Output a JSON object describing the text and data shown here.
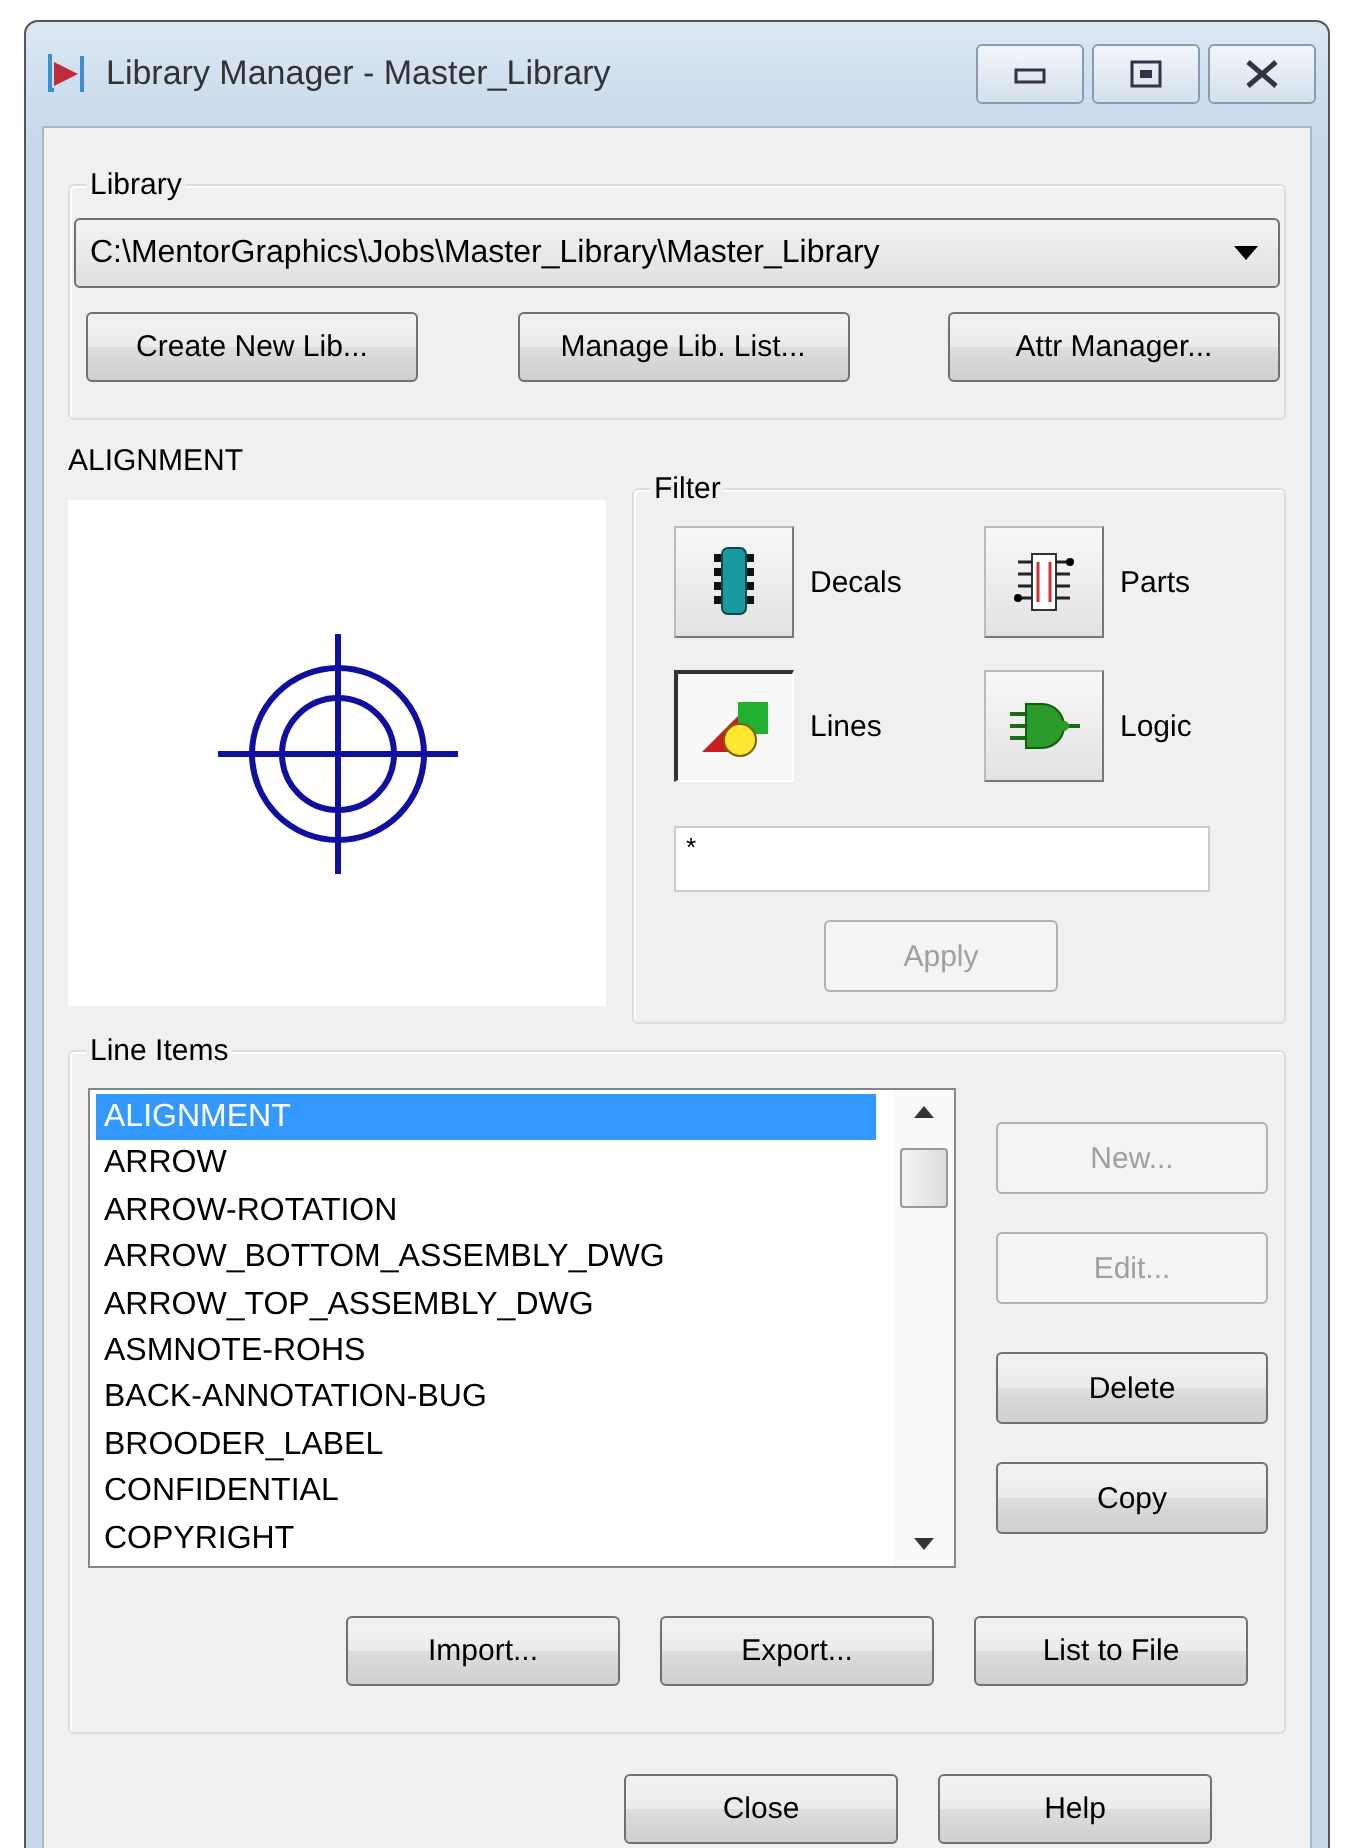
{
  "window": {
    "title": "Library Manager - Master_Library"
  },
  "library": {
    "label": "Library",
    "path": "C:\\MentorGraphics\\Jobs\\Master_Library\\Master_Library",
    "buttons": [
      {
        "label": "Create New Lib..."
      },
      {
        "label": "Manage Lib. List..."
      },
      {
        "label": "Attr Manager..."
      }
    ]
  },
  "preview": {
    "title": "ALIGNMENT"
  },
  "filter": {
    "label": "Filter",
    "pattern": "*",
    "apply": {
      "label": "Apply",
      "disabled": true
    },
    "options": [
      {
        "kind": "decals",
        "label": "Decals",
        "selected": false
      },
      {
        "kind": "parts",
        "label": "Parts",
        "selected": false
      },
      {
        "kind": "lines",
        "label": "Lines",
        "selected": true
      },
      {
        "kind": "logic",
        "label": "Logic",
        "selected": false
      }
    ]
  },
  "line_items": {
    "label": "Line Items",
    "items": [
      {
        "label": "ALIGNMENT",
        "selected": true
      },
      {
        "label": "ARROW",
        "selected": false
      },
      {
        "label": "ARROW-ROTATION",
        "selected": false
      },
      {
        "label": "ARROW_BOTTOM_ASSEMBLY_DWG",
        "selected": false
      },
      {
        "label": "ARROW_TOP_ASSEMBLY_DWG",
        "selected": false
      },
      {
        "label": "ASMNOTE-ROHS",
        "selected": false
      },
      {
        "label": "BACK-ANNOTATION-BUG",
        "selected": false
      },
      {
        "label": "BROODER_LABEL",
        "selected": false
      },
      {
        "label": "CONFIDENTIAL",
        "selected": false
      },
      {
        "label": "COPYRIGHT",
        "selected": false
      }
    ],
    "side_buttons": [
      {
        "label": "New...",
        "disabled": true
      },
      {
        "label": "Edit...",
        "disabled": true
      },
      {
        "label": "Delete",
        "disabled": false
      },
      {
        "label": "Copy",
        "disabled": false
      }
    ],
    "bottom_buttons": [
      {
        "label": "Import..."
      },
      {
        "label": "Export..."
      },
      {
        "label": "List to File"
      }
    ]
  },
  "footer_buttons": [
    {
      "label": "Close"
    },
    {
      "label": "Help"
    }
  ]
}
